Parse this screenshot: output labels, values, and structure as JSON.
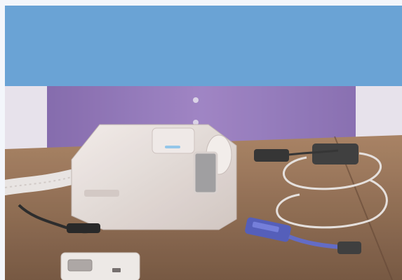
{
  "banner": {
    "color": "#6aa3d5",
    "text": ""
  },
  "video": {
    "caption": "",
    "scene_description_icons": [
      "cpap-device-icon",
      "oximeter-sensor-icon",
      "cable-icon",
      "adapter-module-icon",
      "hose-icon"
    ]
  },
  "colors": {
    "page_bg": "#f3f6fb",
    "table": "#8a6a50",
    "shirt": "#8a6fae",
    "device": "#e7e1de",
    "sensor": "#4b56b6"
  }
}
